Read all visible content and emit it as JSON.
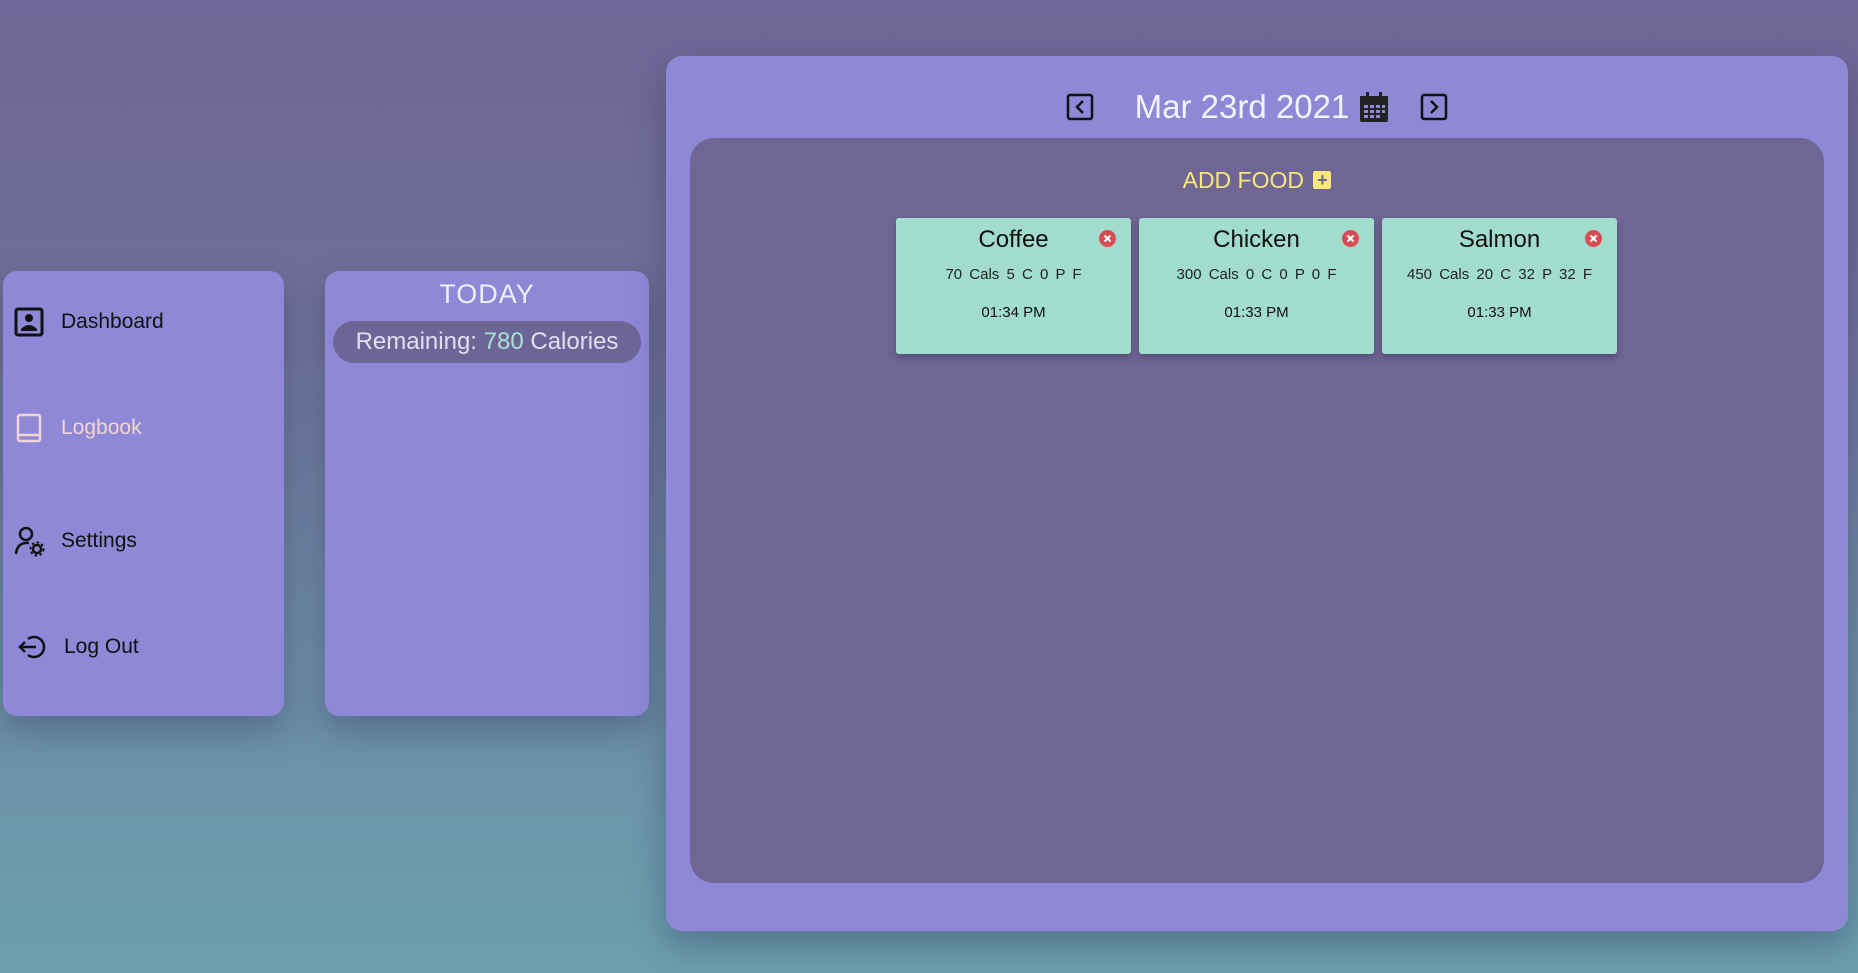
{
  "sidebar": {
    "items": [
      {
        "label": "Dashboard",
        "icon": "profile-icon"
      },
      {
        "label": "Logbook",
        "icon": "book-icon"
      },
      {
        "label": "Settings",
        "icon": "user-gear-icon"
      },
      {
        "label": "Log Out",
        "icon": "logout-icon"
      }
    ],
    "active": "Logbook"
  },
  "today": {
    "title": "TODAY",
    "remaining_prefix": "Remaining:",
    "remaining_value": "780",
    "remaining_suffix": "Calories"
  },
  "logbook": {
    "date": "Mar 23rd 2021",
    "add_food_label": "ADD FOOD",
    "entries": [
      {
        "name": "Coffee",
        "macros": "70 Cals 5 C 0 P F",
        "time": "01:34 PM"
      },
      {
        "name": "Chicken",
        "macros": "300 Cals 0 C 0 P 0 F",
        "time": "01:33 PM"
      },
      {
        "name": "Salmon",
        "macros": "450 Cals 20 C 32 P 32 F",
        "time": "01:33 PM"
      }
    ]
  },
  "colors": {
    "panel": "#8f88d6",
    "inner": "#6f6696",
    "card": "#a2dccd",
    "accent_yellow": "#f6e87a",
    "delete_red": "#d94a57"
  }
}
